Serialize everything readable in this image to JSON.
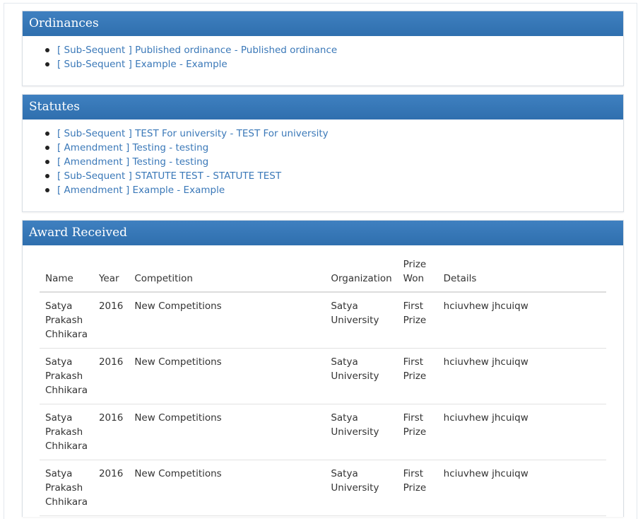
{
  "ordinances": {
    "title": "Ordinances",
    "items": [
      {
        "label": "[ Sub-Sequent ] Published ordinance - Published ordinance"
      },
      {
        "label": "[ Sub-Sequent ] Example - Example"
      }
    ]
  },
  "statutes": {
    "title": "Statutes",
    "items": [
      {
        "label": "[ Sub-Sequent ] TEST For university - TEST For university"
      },
      {
        "label": "[ Amendment ] Testing - testing"
      },
      {
        "label": "[ Amendment ] Testing - testing"
      },
      {
        "label": "[ Sub-Sequent ] STATUTE TEST - STATUTE TEST"
      },
      {
        "label": "[ Amendment ] Example - Example"
      }
    ]
  },
  "awards": {
    "title": "Award Received",
    "columns": {
      "name": "Name",
      "year": "Year",
      "competition": "Competition",
      "organization": "Organization",
      "prize_won": "Prize Won",
      "details": "Details"
    },
    "rows": [
      {
        "name": "Satya Prakash Chhikara",
        "year": "2016",
        "competition": "New Competitions",
        "organization": "Satya University",
        "prize_won": "First Prize",
        "details": "hciuvhew jhcuiqw"
      },
      {
        "name": "Satya Prakash Chhikara",
        "year": "2016",
        "competition": "New Competitions",
        "organization": "Satya University",
        "prize_won": "First Prize",
        "details": "hciuvhew jhcuiqw"
      },
      {
        "name": "Satya Prakash Chhikara",
        "year": "2016",
        "competition": "New Competitions",
        "organization": "Satya University",
        "prize_won": "First Prize",
        "details": "hciuvhew jhcuiqw"
      },
      {
        "name": "Satya Prakash Chhikara",
        "year": "2016",
        "competition": "New Competitions",
        "organization": "Satya University",
        "prize_won": "First Prize",
        "details": "hciuvhew jhcuiqw"
      }
    ]
  },
  "colors": {
    "header_blue": "#3476b8",
    "link_blue": "#3a78b8",
    "text": "#333333"
  }
}
